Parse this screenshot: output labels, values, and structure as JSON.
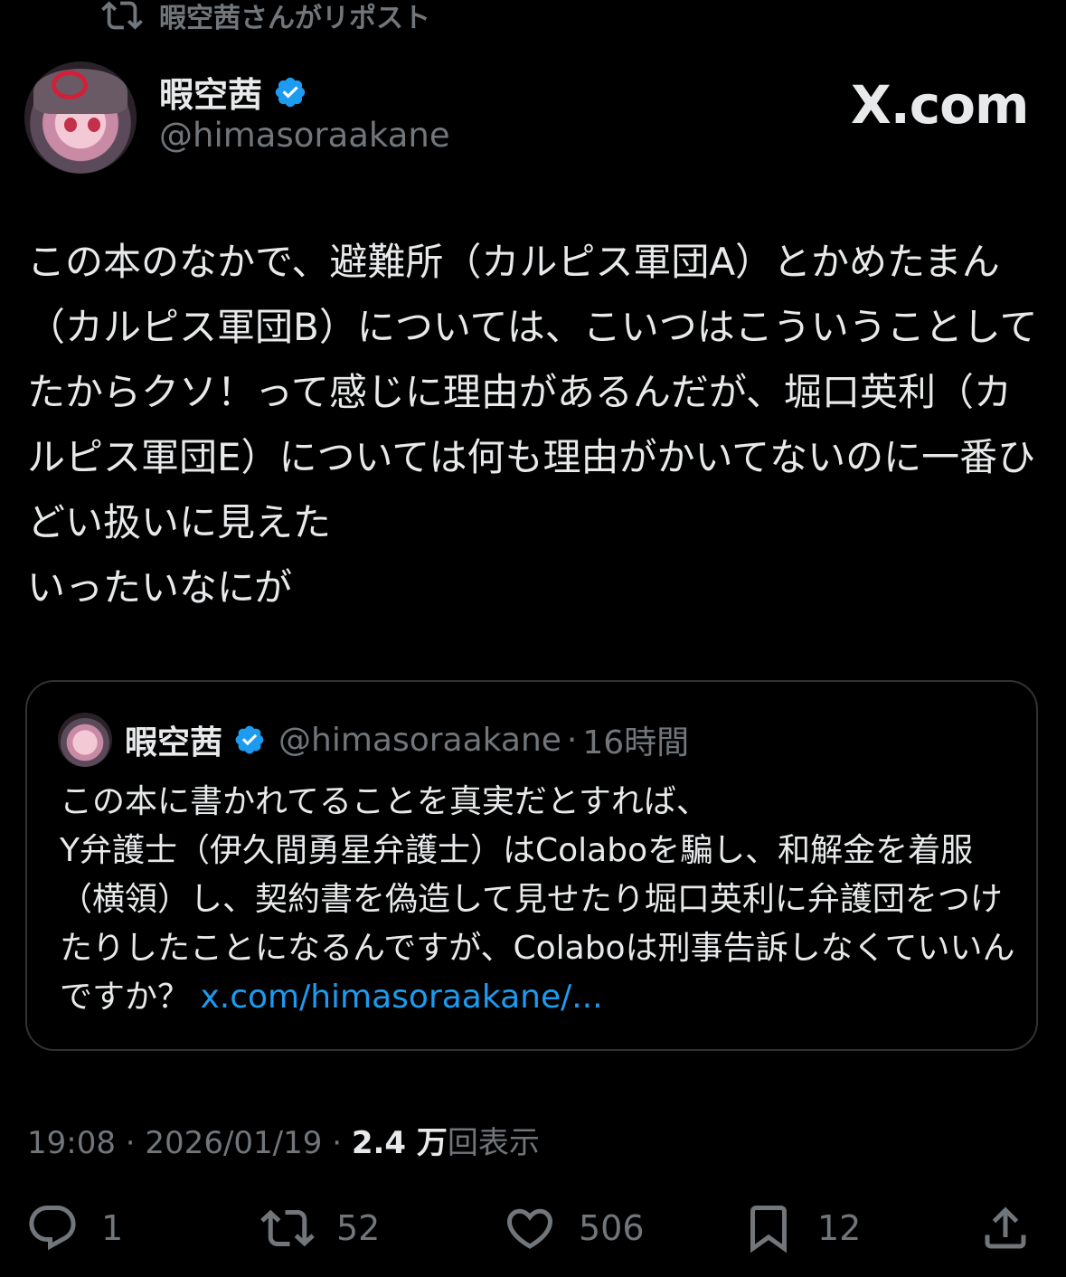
{
  "repost": {
    "label": "暇空茜さんがリポスト",
    "icon": "repost-icon"
  },
  "author": {
    "name": "暇空茜",
    "handle": "@himasoraakane",
    "verified": true
  },
  "site_logo": "X.com",
  "post": {
    "text": "この本のなかで、避難所（カルピス軍団A）とかめたまん（カルピス軍団B）については、こいつはこういうことしてたからクソ！って感じに理由があるんだが、堀口英利（カルピス軍団E）については何も理由がかいてないのに一番ひどい扱いに見えた\nいったいなにが"
  },
  "quote": {
    "name": "暇空茜",
    "handle": "@himasoraakane",
    "separator": "·",
    "time": "16時間",
    "text": "この本に書かれてることを真実だとすれば、\nY弁護士（伊久間勇星弁護士）はColaboを騙し、和解金を着服（横領）し、契約書を偽造して見せたり堀口英利に弁護団をつけたりしたことになるんですが、Colaboは刑事告訴しなくていいんですか？ ",
    "link": "x.com/himasoraakane/..."
  },
  "stats": {
    "time": "19:08",
    "sep1": " · ",
    "date": "2026/01/19",
    "sep2": " · ",
    "views_count": "2.4 万",
    "views_label": "回表示"
  },
  "actions": {
    "reply_count": "1",
    "repost_count": "52",
    "like_count": "506",
    "bookmark_count": "12"
  },
  "colors": {
    "background": "#000000",
    "text": "#e7e9ea",
    "muted": "#71767b",
    "link": "#1d9bf0",
    "verified": "#1d9bf0"
  }
}
